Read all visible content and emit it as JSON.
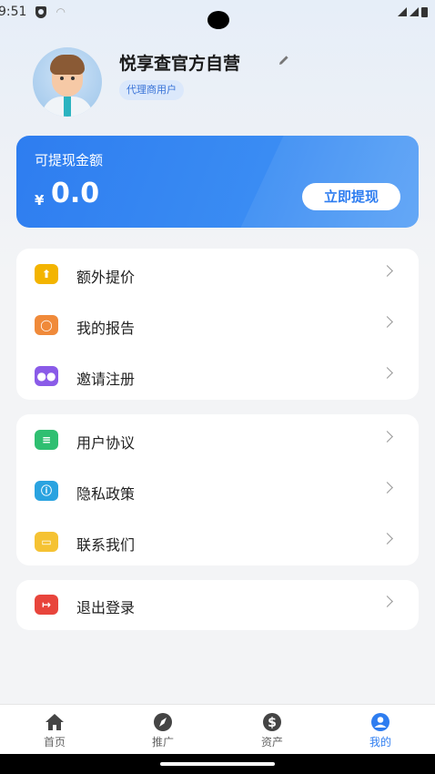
{
  "status_bar": {
    "time": "9:51"
  },
  "profile": {
    "name": "悦享查官方自营",
    "role": "代理商用户"
  },
  "balance": {
    "label": "可提现金额",
    "currency": "¥",
    "amount": "0.0",
    "withdraw_label": "立即提现",
    "accent": "#2e7df0"
  },
  "menu_group_1": [
    {
      "label": "额外提价",
      "icon": "upload-icon",
      "color": "#f3b400"
    },
    {
      "label": "我的报告",
      "icon": "report-icon",
      "color": "#f08a3a"
    },
    {
      "label": "邀请注册",
      "icon": "users-icon",
      "color": "#8a5be8"
    }
  ],
  "menu_group_2": [
    {
      "label": "用户协议",
      "icon": "document-icon",
      "color": "#2fbf71"
    },
    {
      "label": "隐私政策",
      "icon": "info-icon",
      "color": "#2aa3e0"
    },
    {
      "label": "联系我们",
      "icon": "briefcase-icon",
      "color": "#f5c233"
    }
  ],
  "menu_group_3": [
    {
      "label": "退出登录",
      "icon": "logout-icon",
      "color": "#e8453c"
    }
  ],
  "bottom_nav": [
    {
      "label": "首页",
      "icon": "home-icon"
    },
    {
      "label": "推广",
      "icon": "compass-icon"
    },
    {
      "label": "资产",
      "icon": "dollar-icon"
    },
    {
      "label": "我的",
      "icon": "user-icon",
      "active": true
    }
  ]
}
